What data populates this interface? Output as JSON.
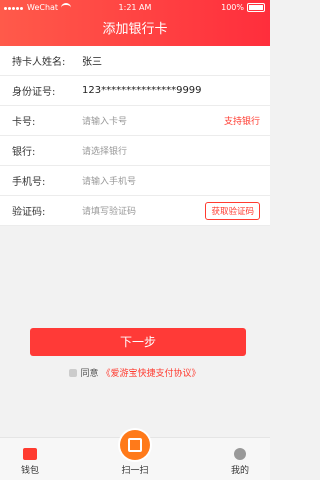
{
  "status": {
    "carrier": "WeChat",
    "time": "1:21 AM",
    "battery": "100%"
  },
  "header": {
    "title": "添加银行卡"
  },
  "form": {
    "name_label": "持卡人姓名:",
    "name_value": "张三",
    "id_label": "身份证号:",
    "id_value": "123***************9999",
    "card_label": "卡号:",
    "card_placeholder": "请输入卡号",
    "support_label": "支持银行",
    "bank_label": "银行:",
    "bank_placeholder": "请选择银行",
    "phone_label": "手机号:",
    "phone_placeholder": "请输入手机号",
    "code_label": "验证码:",
    "code_placeholder": "请填写验证码",
    "get_code_label": "获取验证码"
  },
  "actions": {
    "next_label": "下一步"
  },
  "agreement": {
    "prefix": "同意",
    "link": "《爱游宝快捷支付协议》"
  },
  "tabbar": {
    "wallet": "钱包",
    "scan": "扫一扫",
    "mine": "我的"
  },
  "colors": {
    "primary": "#ff3a37",
    "scan": "#ff7a1a"
  }
}
